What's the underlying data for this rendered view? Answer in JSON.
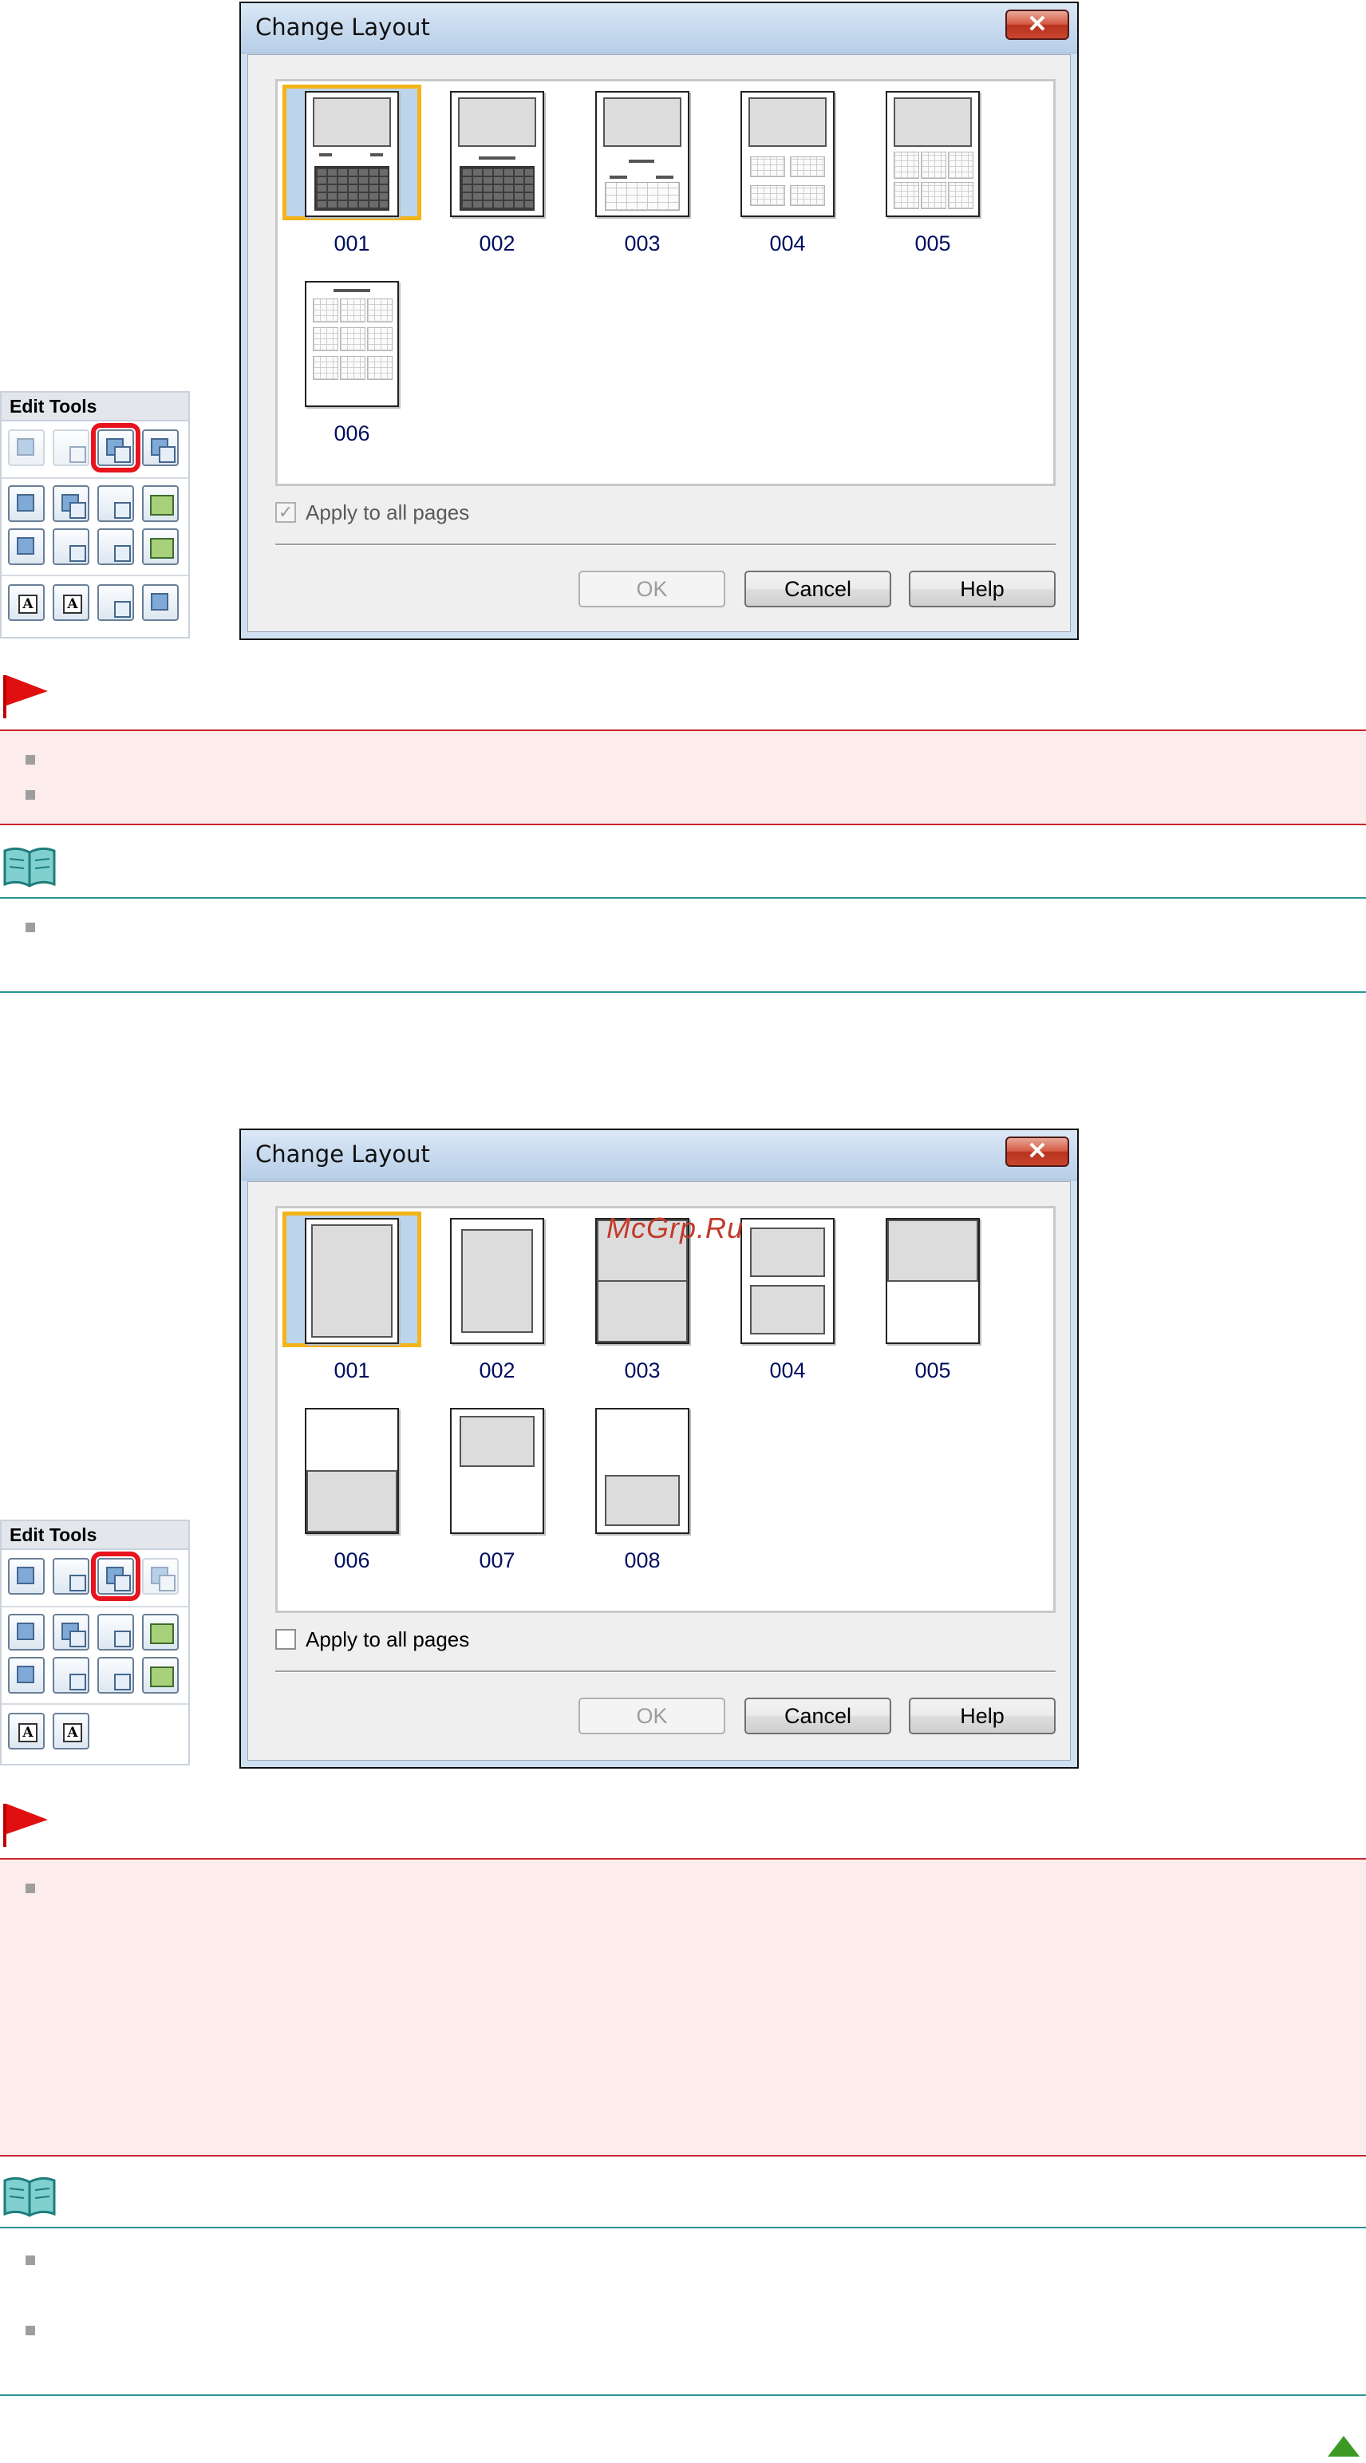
{
  "palette1": {
    "header": "Edit Tools"
  },
  "dialog1": {
    "title": "Change Layout",
    "close_glyph": "✕",
    "items": [
      "001",
      "002",
      "003",
      "004",
      "005",
      "006"
    ],
    "selected_index": 0,
    "apply_all_label": "Apply to all pages",
    "apply_all_checked": true,
    "apply_all_enabled": false,
    "ok_label": "OK",
    "cancel_label": "Cancel",
    "help_label": "Help"
  },
  "palette2": {
    "header": "Edit Tools"
  },
  "dialog2": {
    "title": "Change Layout",
    "close_glyph": "✕",
    "items": [
      "001",
      "002",
      "003",
      "004",
      "005",
      "006",
      "007",
      "008"
    ],
    "selected_index": 0,
    "apply_all_label": "Apply to all pages",
    "apply_all_checked": false,
    "ok_label": "OK",
    "cancel_label": "Cancel",
    "help_label": "Help"
  },
  "watermark": "McGrp.Ru",
  "colors": {
    "important_accent": "#c8262d",
    "note_accent": "#2c9494",
    "highlight": "#e8141d",
    "selection_border": "#f2b419"
  },
  "icons": {
    "important": "red-flag-icon",
    "note": "open-book-icon",
    "page_top": "green-up-arrow-icon"
  }
}
